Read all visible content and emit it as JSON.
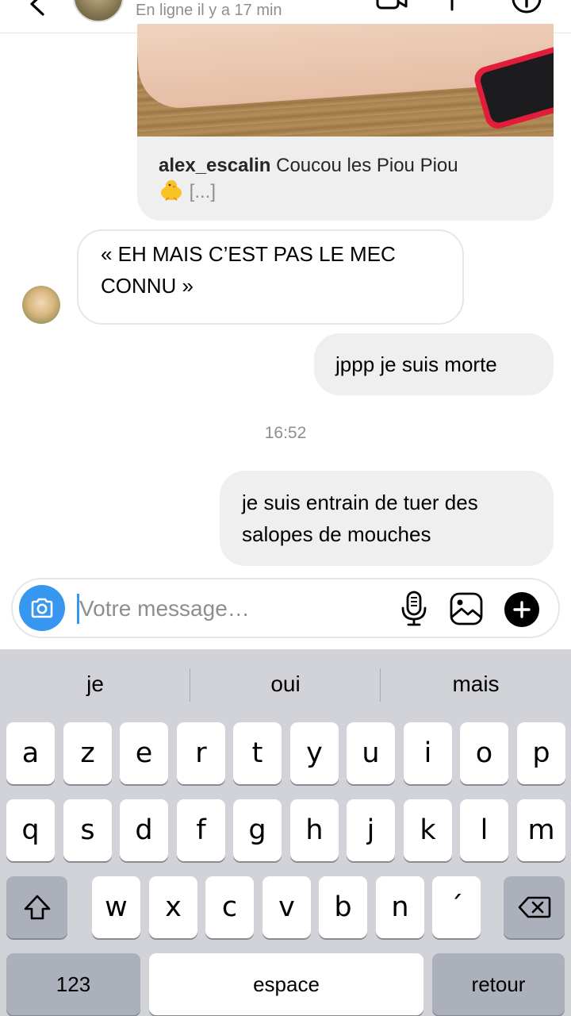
{
  "header": {
    "status": "En ligne il y a 17 min"
  },
  "shared_post": {
    "username": "alex_escalin",
    "caption": "Coucou les Piou Piou",
    "emoji": "baby-chick-icon",
    "more": "[...]"
  },
  "messages": [
    {
      "direction": "incoming",
      "text": "« EH MAIS C’EST PAS LE MEC CONNU »"
    },
    {
      "direction": "outgoing",
      "text": "jppp je suis morte"
    },
    {
      "direction": "outgoing",
      "text": "je suis entrain de tuer des salopes de mouches"
    }
  ],
  "timestamp": "16:52",
  "composer": {
    "placeholder": "Votre message…",
    "value": "",
    "icons": [
      "camera-icon",
      "microphone-icon",
      "gallery-icon",
      "plus-icon"
    ]
  },
  "keyboard": {
    "suggestions": [
      "je",
      "oui",
      "mais"
    ],
    "row1": [
      "a",
      "z",
      "e",
      "r",
      "t",
      "y",
      "u",
      "i",
      "o",
      "p"
    ],
    "row2": [
      "q",
      "s",
      "d",
      "f",
      "g",
      "h",
      "j",
      "k",
      "l",
      "m"
    ],
    "row3": [
      "w",
      "x",
      "c",
      "v",
      "b",
      "n",
      "´"
    ],
    "numbers_key": "123",
    "space_key": "espace",
    "return_key": "retour"
  },
  "colors": {
    "accent": "#3797f0",
    "bubble_outgoing": "#efefef",
    "keyboard_bg": "#d1d3d9"
  }
}
